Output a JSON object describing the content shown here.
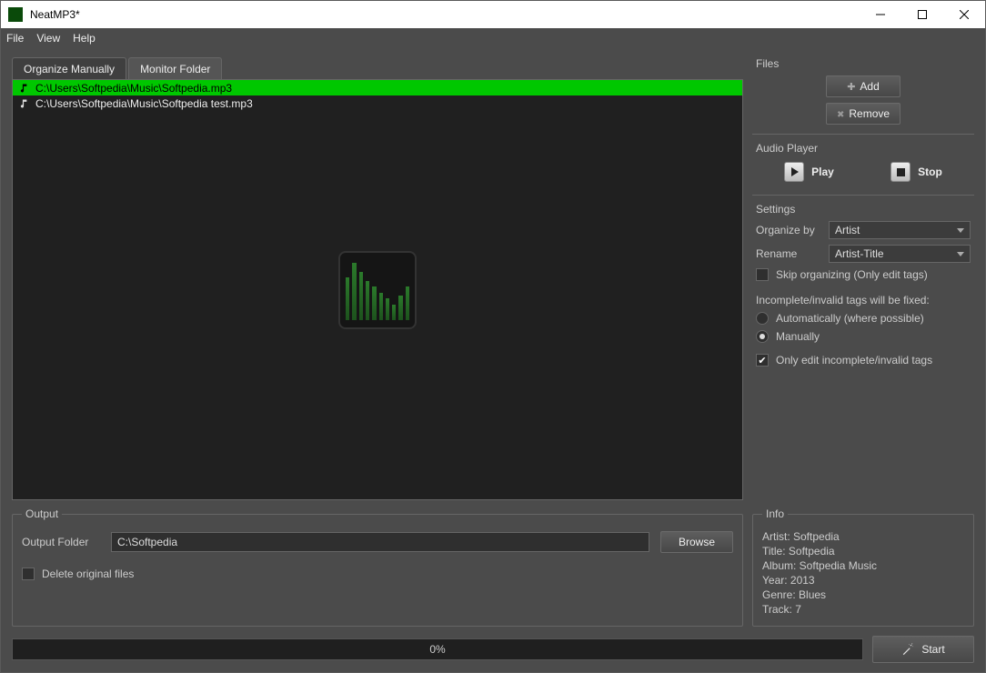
{
  "window": {
    "title": "NeatMP3*"
  },
  "menu": {
    "file": "File",
    "view": "View",
    "help": "Help"
  },
  "tabs": {
    "organize": "Organize Manually",
    "monitor": "Monitor Folder"
  },
  "files": [
    {
      "path": "C:\\Users\\Softpedia\\Music\\Softpedia.mp3",
      "selected": true
    },
    {
      "path": "C:\\Users\\Softpedia\\Music\\Softpedia test.mp3",
      "selected": false
    }
  ],
  "panel": {
    "files": {
      "title": "Files",
      "add": "Add",
      "remove": "Remove"
    },
    "player": {
      "title": "Audio Player",
      "play": "Play",
      "stop": "Stop"
    },
    "settings": {
      "title": "Settings",
      "organize_by_label": "Organize by",
      "organize_by_value": "Artist",
      "rename_label": "Rename",
      "rename_value": "Artist-Title",
      "skip": "Skip organizing (Only edit tags)",
      "fix_header": "Incomplete/invalid tags will be fixed:",
      "auto": "Automatically (where possible)",
      "manual": "Manually",
      "only_invalid": "Only edit incomplete/invalid tags"
    },
    "info": {
      "title": "Info",
      "artist": "Artist: Softpedia",
      "track_title": "Title: Softpedia",
      "album": "Album: Softpedia Music",
      "year": "Year: 2013",
      "genre": "Genre: Blues",
      "track": "Track: 7"
    }
  },
  "output": {
    "title": "Output",
    "folder_label": "Output Folder",
    "folder_value": "C:\\Softpedia",
    "browse": "Browse",
    "delete_originals": "Delete original files"
  },
  "footer": {
    "progress": "0%",
    "start": "Start"
  }
}
